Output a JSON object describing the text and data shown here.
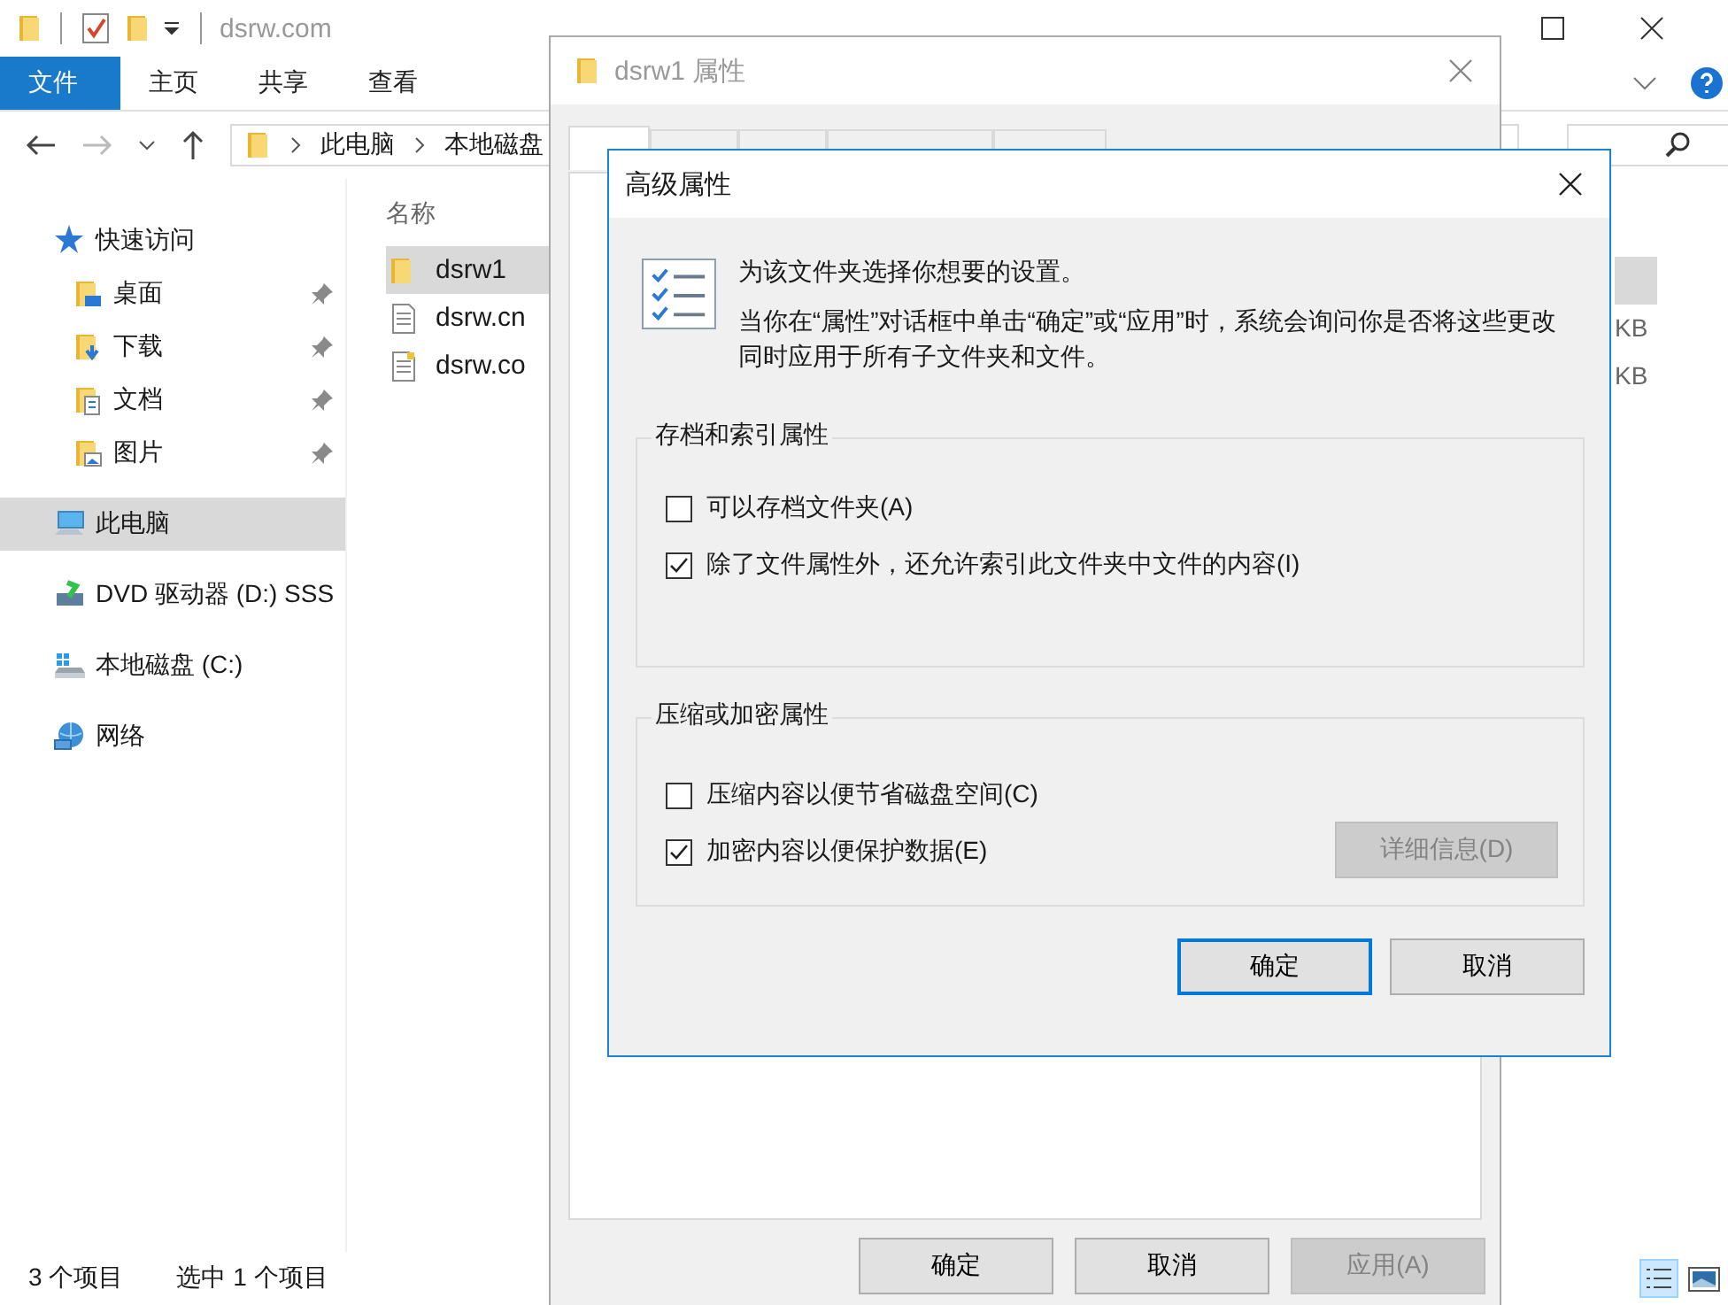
{
  "explorer": {
    "title": "dsrw.com",
    "ribbon_tabs": [
      {
        "label": "文件",
        "selected": true
      },
      {
        "label": "主页",
        "selected": false
      },
      {
        "label": "共享",
        "selected": false
      },
      {
        "label": "查看",
        "selected": false
      }
    ],
    "address": [
      "此电脑",
      "本地磁盘"
    ],
    "sidebar": [
      {
        "label": "快速访问",
        "kind": "star",
        "selected": false,
        "children": [
          {
            "label": "桌面",
            "kind": "desktop",
            "pinned": true
          },
          {
            "label": "下载",
            "kind": "download",
            "pinned": true
          },
          {
            "label": "文档",
            "kind": "documents",
            "pinned": true
          },
          {
            "label": "图片",
            "kind": "pictures",
            "pinned": true
          }
        ]
      },
      {
        "label": "此电脑",
        "kind": "pc",
        "selected": true
      },
      {
        "label": "DVD 驱动器 (D:) SSS",
        "kind": "dvd",
        "selected": false
      },
      {
        "label": "本地磁盘 (C:)",
        "kind": "drive",
        "selected": false
      },
      {
        "label": "网络",
        "kind": "network",
        "selected": false
      }
    ],
    "column_header": "名称",
    "files": [
      {
        "name": "dsrw1",
        "kind": "folder",
        "selected": true
      },
      {
        "name": "dsrw.cn",
        "kind": "text",
        "selected": false
      },
      {
        "name": "dsrw.co",
        "kind": "doc",
        "selected": false
      }
    ],
    "size_column": [
      "KB",
      "KB"
    ],
    "status_bar": [
      "3 个项目",
      "选中 1 个项目"
    ]
  },
  "properties_dialog": {
    "title": "dsrw1 属性",
    "tabs": [
      {
        "selected": true
      },
      {
        "selected": false
      },
      {
        "selected": false
      },
      {
        "selected": false
      },
      {
        "selected": false
      }
    ],
    "buttons": [
      {
        "label": "确定",
        "disabled": false
      },
      {
        "label": "取消",
        "disabled": false
      },
      {
        "label": "应用(A)",
        "disabled": true
      }
    ]
  },
  "advanced_dialog": {
    "title": "高级属性",
    "heading": "为该文件夹选择你想要的设置。",
    "description": "当你在“属性”对话框中单击“确定”或“应用”时，系统会询问你是否将这些更改同时应用于所有子文件夹和文件。",
    "groups": [
      {
        "title": "存档和索引属性",
        "options": [
          {
            "label": "可以存档文件夹(A)",
            "checked": false
          },
          {
            "label": "除了文件属性外，还允许索引此文件夹中文件的内容(I)",
            "checked": true
          }
        ]
      },
      {
        "title": "压缩或加密属性",
        "options": [
          {
            "label": "压缩内容以便节省磁盘空间(C)",
            "checked": false
          },
          {
            "label": "加密内容以便保护数据(E)",
            "checked": true
          }
        ],
        "button": {
          "label": "详细信息(D)",
          "disabled": true
        }
      }
    ],
    "buttons": [
      {
        "label": "确定",
        "default": true
      },
      {
        "label": "取消",
        "default": false
      }
    ]
  }
}
